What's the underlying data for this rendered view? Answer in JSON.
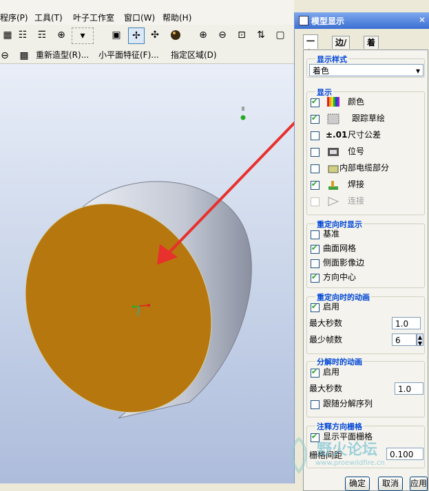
{
  "menu": {
    "items": [
      "程序(P)",
      "工具(T)",
      "叶子工作室",
      "窗口(W)",
      "帮助(H)"
    ]
  },
  "toolbar": {
    "item_regenerate": "重新造型(R)...",
    "item_small_plane": "小平面特征(F)...",
    "item_specify_region": "指定区域(D)"
  },
  "dialog": {
    "title": "模型显示",
    "tabs": [
      "一般",
      "边/线",
      "着色"
    ],
    "display_style": {
      "legend": "显示样式",
      "selected": "着色"
    },
    "display": {
      "legend": "显示",
      "items": [
        {
          "label": "颜色",
          "checked": true,
          "enabled": true,
          "icon": "color-palette-icon"
        },
        {
          "label": "跟踪草绘",
          "checked": true,
          "enabled": true,
          "icon": "trace-sketch-icon"
        },
        {
          "label": "尺寸公差",
          "checked": false,
          "enabled": true,
          "icon": "tolerance-icon"
        },
        {
          "label": "位号",
          "checked": false,
          "enabled": true,
          "icon": "ref-designator-icon"
        },
        {
          "label": "内部电缆部分",
          "checked": false,
          "enabled": true,
          "icon": "cable-icon"
        },
        {
          "label": "焊接",
          "checked": true,
          "enabled": true,
          "icon": "weld-icon"
        },
        {
          "label": "连接",
          "checked": false,
          "enabled": false,
          "icon": "connection-icon"
        }
      ]
    },
    "reorient_display": {
      "legend": "重定向时显示",
      "items": [
        {
          "label": "基准",
          "checked": false
        },
        {
          "label": "曲面网格",
          "checked": true
        },
        {
          "label": "侧面影像边",
          "checked": false
        },
        {
          "label": "方向中心",
          "checked": true
        }
      ]
    },
    "reorient_animation": {
      "legend": "重定向时的动画",
      "enable_label": "启用",
      "enabled": true,
      "max_seconds_label": "最大秒数",
      "max_seconds": "1.0",
      "min_fps_label": "最少帧数",
      "min_fps": "6"
    },
    "explode_animation": {
      "legend": "分解时的动画",
      "enable_label": "启用",
      "enabled": true,
      "max_seconds_label": "最大秒数",
      "max_seconds": "1.0",
      "follow_label": "跟随分解序列",
      "follow": false
    },
    "annotation_grid": {
      "legend": "注释方向栅格",
      "show_label": "显示平面栅格",
      "show": true,
      "spacing_label": "栅格间距",
      "spacing": "0.100"
    },
    "buttons": {
      "ok": "确定",
      "cancel": "取消",
      "apply": "应用"
    }
  },
  "watermark": {
    "text": "野火论坛",
    "sub": "www.proewildfire.cn"
  },
  "colors": {
    "face": "#b5770e",
    "accent": "#0046d5",
    "arrow": "#e8302c"
  }
}
